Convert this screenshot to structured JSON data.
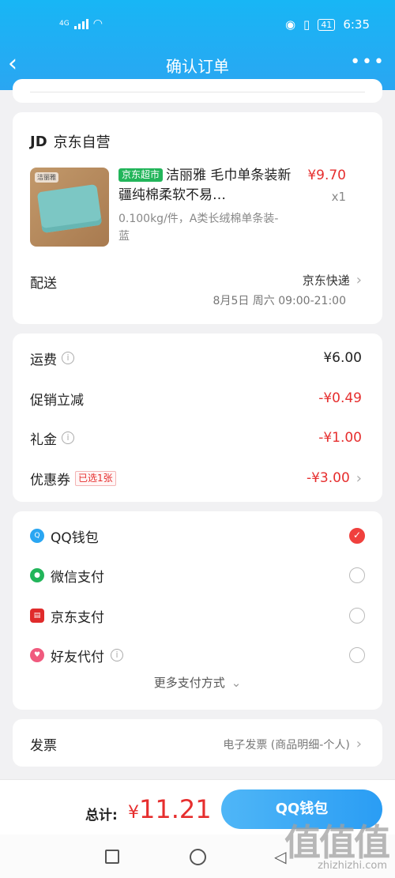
{
  "status": {
    "net": "4G",
    "time": "6:35",
    "battery": "41"
  },
  "nav": {
    "back": "‹",
    "title": "确认订单",
    "more": "•••"
  },
  "store": {
    "logo": "JD",
    "name": "京东自营"
  },
  "product": {
    "tag": "京东超市",
    "title": "洁丽雅 毛巾单条装新疆纯棉柔软不易…",
    "price": "¥9.70",
    "qty": "x1",
    "spec": "0.100kg/件，A类长绒棉单条装-蓝",
    "brand_mini": "洁丽雅"
  },
  "delivery": {
    "label": "配送",
    "method": "京东快递",
    "time": "8月5日 周六 09:00-21:00"
  },
  "fees": [
    {
      "label": "运费",
      "info": true,
      "value": "¥6.00",
      "red": false
    },
    {
      "label": "促销立减",
      "info": false,
      "value": "-¥0.49",
      "red": true
    },
    {
      "label": "礼金",
      "info": true,
      "value": "-¥1.00",
      "red": true
    },
    {
      "label": "优惠券",
      "badge": "已选1张",
      "value": "-¥3.00",
      "red": true,
      "chevron": true
    }
  ],
  "payment": {
    "options": [
      {
        "label": "QQ钱包",
        "icon": "qq-icon",
        "selected": true
      },
      {
        "label": "微信支付",
        "icon": "wechat-icon",
        "selected": false
      },
      {
        "label": "京东支付",
        "icon": "jdpay-icon",
        "selected": false
      },
      {
        "label": "好友代付",
        "icon": "friend-pay-icon",
        "selected": false,
        "info": true
      }
    ],
    "more": "更多支付方式"
  },
  "invoice": {
    "label": "发票",
    "value": "电子发票 (商品明细-个人)"
  },
  "footer": {
    "total_label": "总计:",
    "currency": "¥",
    "total": "11.21",
    "pay_button": "QQ钱包"
  },
  "watermark": {
    "text": "值值值",
    "url": "zhizhizhi.com"
  },
  "colors": {
    "accent": "#2aa6f2",
    "price_red": "#e62e2e",
    "tag_green": "#22b55a"
  }
}
